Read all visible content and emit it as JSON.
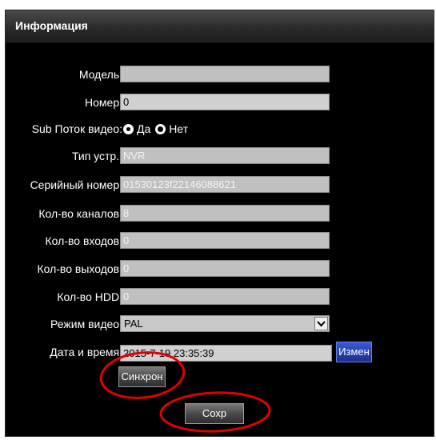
{
  "header": {
    "title": "Информация"
  },
  "fields": {
    "model": {
      "label": "Модель:",
      "value": ""
    },
    "number": {
      "label": "Номер:",
      "value": "0"
    },
    "sub_stream": {
      "label": "Sub Поток видео:",
      "option_yes": "Да",
      "option_no": "Нет",
      "selected": "Нет"
    },
    "device_type": {
      "label": "Тип устр.:",
      "value": "NVR"
    },
    "serial": {
      "label": "Серийный номер:",
      "value": "01530123f22146088621"
    },
    "channels": {
      "label": "Кол-во каналов:",
      "value": "8"
    },
    "inputs": {
      "label": "Кол-во входов:",
      "value": "0"
    },
    "outputs": {
      "label": "Кол-во выходов:",
      "value": "0"
    },
    "hdd": {
      "label": "Кол-во HDD:",
      "value": "0"
    },
    "video_mode": {
      "label": "Режим видео:",
      "value": "PAL"
    },
    "datetime": {
      "label": "Дата и время:",
      "value": "2015-7-19 23:35:39"
    }
  },
  "buttons": {
    "change": "Измен",
    "sync": "Синхрон",
    "save": "Сохр"
  },
  "colors": {
    "panel_bg": "#000000",
    "field_bg": "#c0c0c0",
    "change_button": "#2540b0",
    "annotation": "#e00000"
  }
}
